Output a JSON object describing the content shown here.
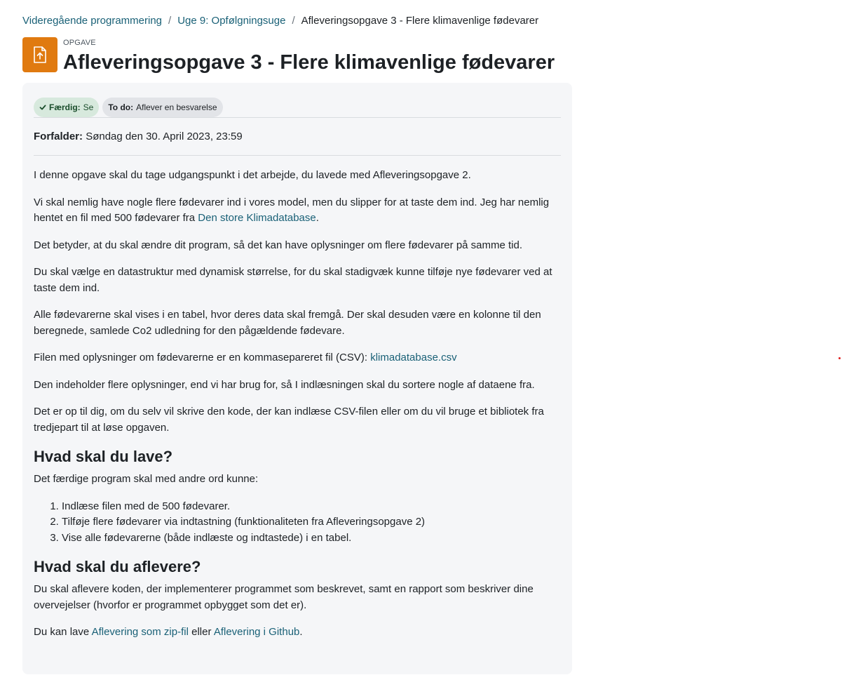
{
  "breadcrumb": {
    "course": "Videregående programmering",
    "section": "Uge 9: Opfølgningsuge",
    "current": "Afleveringsopgave 3 - Flere klimavenlige fødevarer",
    "separator": "/"
  },
  "header": {
    "kicker": "OPGAVE",
    "title": "Afleveringsopgave 3 - Flere klimavenlige fødevarer",
    "icon": "assignment-upload-icon",
    "icon_color": "#e07a10"
  },
  "completion": {
    "done_label": "Færdig:",
    "done_value": "Se",
    "todo_label": "To do:",
    "todo_value": "Aflever en besvarelse"
  },
  "due": {
    "label": "Forfalder:",
    "value": "Søndag den 30. April 2023, 23:59"
  },
  "description": {
    "p1": "I denne opgave skal du tage udgangspunkt i det arbejde, du lavede med Afleveringsopgave 2.",
    "p2_text": "Vi skal nemlig have nogle flere fødevarer ind i vores model, men du slipper for at taste dem ind. Jeg har nemlig hentet en fil med 500 fødevarer fra ",
    "p2_link": "Den store Klimadatabase",
    "p2_end": ".",
    "p3": "Det betyder, at du skal ændre dit program, så det kan have oplysninger om flere fødevarer på samme tid.",
    "p4": "Du skal vælge en datastruktur med dynamisk størrelse, for du skal stadigvæk kunne tilføje nye fødevarer ved at taste dem ind.",
    "p5": "Alle fødevarerne skal vises i en tabel, hvor deres data skal fremgå. Der skal desuden være en kolonne til den beregnede, samlede Co2 udledning for den pågældende fødevare.",
    "p6_text": "Filen med oplysninger om fødevarerne er en kommasepareret fil (CSV): ",
    "p6_link": "klimadatabase.csv",
    "p7": "Den indeholder flere oplysninger, end vi har brug for, så I indlæsningen skal du sortere nogle af dataene fra.",
    "p8": "Det er op til dig, om du selv vil skrive den kode, der kan indlæse CSV-filen eller om du vil bruge et bibliotek fra tredjepart til at løse opgaven.",
    "h1": "Hvad skal du lave?",
    "p9": "Det færdige program skal med andre ord kunne:",
    "list": [
      "Indlæse filen med de 500 fødevarer.",
      "Tilføje flere fødevarer via indtastning (funktionaliteten fra Afleveringsopgave 2)",
      "Vise alle fødevarerne (både indlæste og indtastede) i en tabel."
    ],
    "h2": "Hvad skal du aflevere?",
    "p10": "Du skal aflevere koden, der implementerer programmet som beskrevet, samt en rapport som beskriver dine overvejelser (hvorfor er programmet opbygget som det er).",
    "p11_text": "Du kan lave ",
    "p11_link1": "Aflevering som zip-fil",
    "p11_mid": " eller ",
    "p11_link2": "Aflevering i Github",
    "p11_end": "."
  },
  "colors": {
    "link": "#1a6177",
    "card_bg": "#f5f6f8",
    "done_badge_bg": "#d7e9dd",
    "todo_badge_bg": "#e2e4e8"
  }
}
